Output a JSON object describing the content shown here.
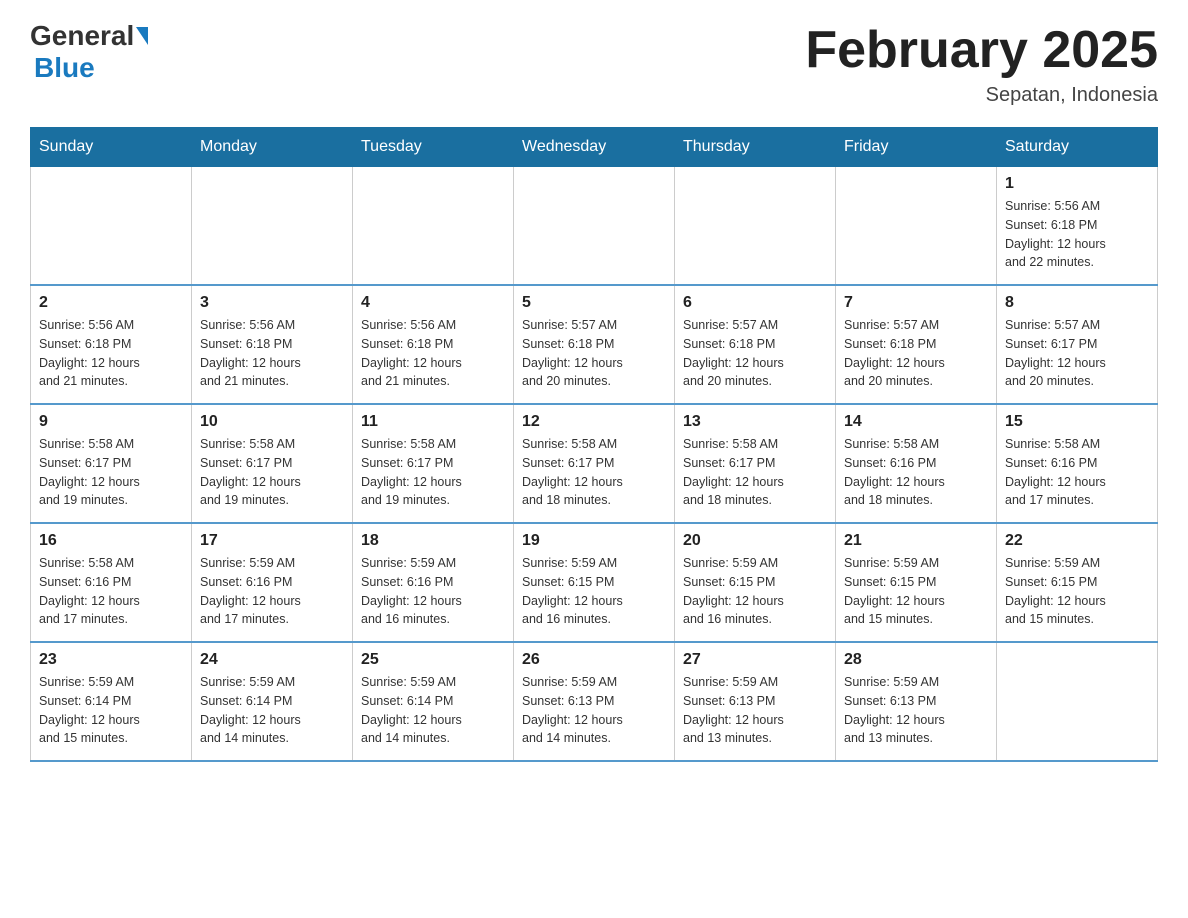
{
  "header": {
    "logo_general": "General",
    "logo_blue": "Blue",
    "month_title": "February 2025",
    "location": "Sepatan, Indonesia"
  },
  "days_of_week": [
    "Sunday",
    "Monday",
    "Tuesday",
    "Wednesday",
    "Thursday",
    "Friday",
    "Saturday"
  ],
  "weeks": [
    {
      "days": [
        {
          "number": "",
          "info": ""
        },
        {
          "number": "",
          "info": ""
        },
        {
          "number": "",
          "info": ""
        },
        {
          "number": "",
          "info": ""
        },
        {
          "number": "",
          "info": ""
        },
        {
          "number": "",
          "info": ""
        },
        {
          "number": "1",
          "info": "Sunrise: 5:56 AM\nSunset: 6:18 PM\nDaylight: 12 hours\nand 22 minutes."
        }
      ]
    },
    {
      "days": [
        {
          "number": "2",
          "info": "Sunrise: 5:56 AM\nSunset: 6:18 PM\nDaylight: 12 hours\nand 21 minutes."
        },
        {
          "number": "3",
          "info": "Sunrise: 5:56 AM\nSunset: 6:18 PM\nDaylight: 12 hours\nand 21 minutes."
        },
        {
          "number": "4",
          "info": "Sunrise: 5:56 AM\nSunset: 6:18 PM\nDaylight: 12 hours\nand 21 minutes."
        },
        {
          "number": "5",
          "info": "Sunrise: 5:57 AM\nSunset: 6:18 PM\nDaylight: 12 hours\nand 20 minutes."
        },
        {
          "number": "6",
          "info": "Sunrise: 5:57 AM\nSunset: 6:18 PM\nDaylight: 12 hours\nand 20 minutes."
        },
        {
          "number": "7",
          "info": "Sunrise: 5:57 AM\nSunset: 6:18 PM\nDaylight: 12 hours\nand 20 minutes."
        },
        {
          "number": "8",
          "info": "Sunrise: 5:57 AM\nSunset: 6:17 PM\nDaylight: 12 hours\nand 20 minutes."
        }
      ]
    },
    {
      "days": [
        {
          "number": "9",
          "info": "Sunrise: 5:58 AM\nSunset: 6:17 PM\nDaylight: 12 hours\nand 19 minutes."
        },
        {
          "number": "10",
          "info": "Sunrise: 5:58 AM\nSunset: 6:17 PM\nDaylight: 12 hours\nand 19 minutes."
        },
        {
          "number": "11",
          "info": "Sunrise: 5:58 AM\nSunset: 6:17 PM\nDaylight: 12 hours\nand 19 minutes."
        },
        {
          "number": "12",
          "info": "Sunrise: 5:58 AM\nSunset: 6:17 PM\nDaylight: 12 hours\nand 18 minutes."
        },
        {
          "number": "13",
          "info": "Sunrise: 5:58 AM\nSunset: 6:17 PM\nDaylight: 12 hours\nand 18 minutes."
        },
        {
          "number": "14",
          "info": "Sunrise: 5:58 AM\nSunset: 6:16 PM\nDaylight: 12 hours\nand 18 minutes."
        },
        {
          "number": "15",
          "info": "Sunrise: 5:58 AM\nSunset: 6:16 PM\nDaylight: 12 hours\nand 17 minutes."
        }
      ]
    },
    {
      "days": [
        {
          "number": "16",
          "info": "Sunrise: 5:58 AM\nSunset: 6:16 PM\nDaylight: 12 hours\nand 17 minutes."
        },
        {
          "number": "17",
          "info": "Sunrise: 5:59 AM\nSunset: 6:16 PM\nDaylight: 12 hours\nand 17 minutes."
        },
        {
          "number": "18",
          "info": "Sunrise: 5:59 AM\nSunset: 6:16 PM\nDaylight: 12 hours\nand 16 minutes."
        },
        {
          "number": "19",
          "info": "Sunrise: 5:59 AM\nSunset: 6:15 PM\nDaylight: 12 hours\nand 16 minutes."
        },
        {
          "number": "20",
          "info": "Sunrise: 5:59 AM\nSunset: 6:15 PM\nDaylight: 12 hours\nand 16 minutes."
        },
        {
          "number": "21",
          "info": "Sunrise: 5:59 AM\nSunset: 6:15 PM\nDaylight: 12 hours\nand 15 minutes."
        },
        {
          "number": "22",
          "info": "Sunrise: 5:59 AM\nSunset: 6:15 PM\nDaylight: 12 hours\nand 15 minutes."
        }
      ]
    },
    {
      "days": [
        {
          "number": "23",
          "info": "Sunrise: 5:59 AM\nSunset: 6:14 PM\nDaylight: 12 hours\nand 15 minutes."
        },
        {
          "number": "24",
          "info": "Sunrise: 5:59 AM\nSunset: 6:14 PM\nDaylight: 12 hours\nand 14 minutes."
        },
        {
          "number": "25",
          "info": "Sunrise: 5:59 AM\nSunset: 6:14 PM\nDaylight: 12 hours\nand 14 minutes."
        },
        {
          "number": "26",
          "info": "Sunrise: 5:59 AM\nSunset: 6:13 PM\nDaylight: 12 hours\nand 14 minutes."
        },
        {
          "number": "27",
          "info": "Sunrise: 5:59 AM\nSunset: 6:13 PM\nDaylight: 12 hours\nand 13 minutes."
        },
        {
          "number": "28",
          "info": "Sunrise: 5:59 AM\nSunset: 6:13 PM\nDaylight: 12 hours\nand 13 minutes."
        },
        {
          "number": "",
          "info": ""
        }
      ]
    }
  ]
}
